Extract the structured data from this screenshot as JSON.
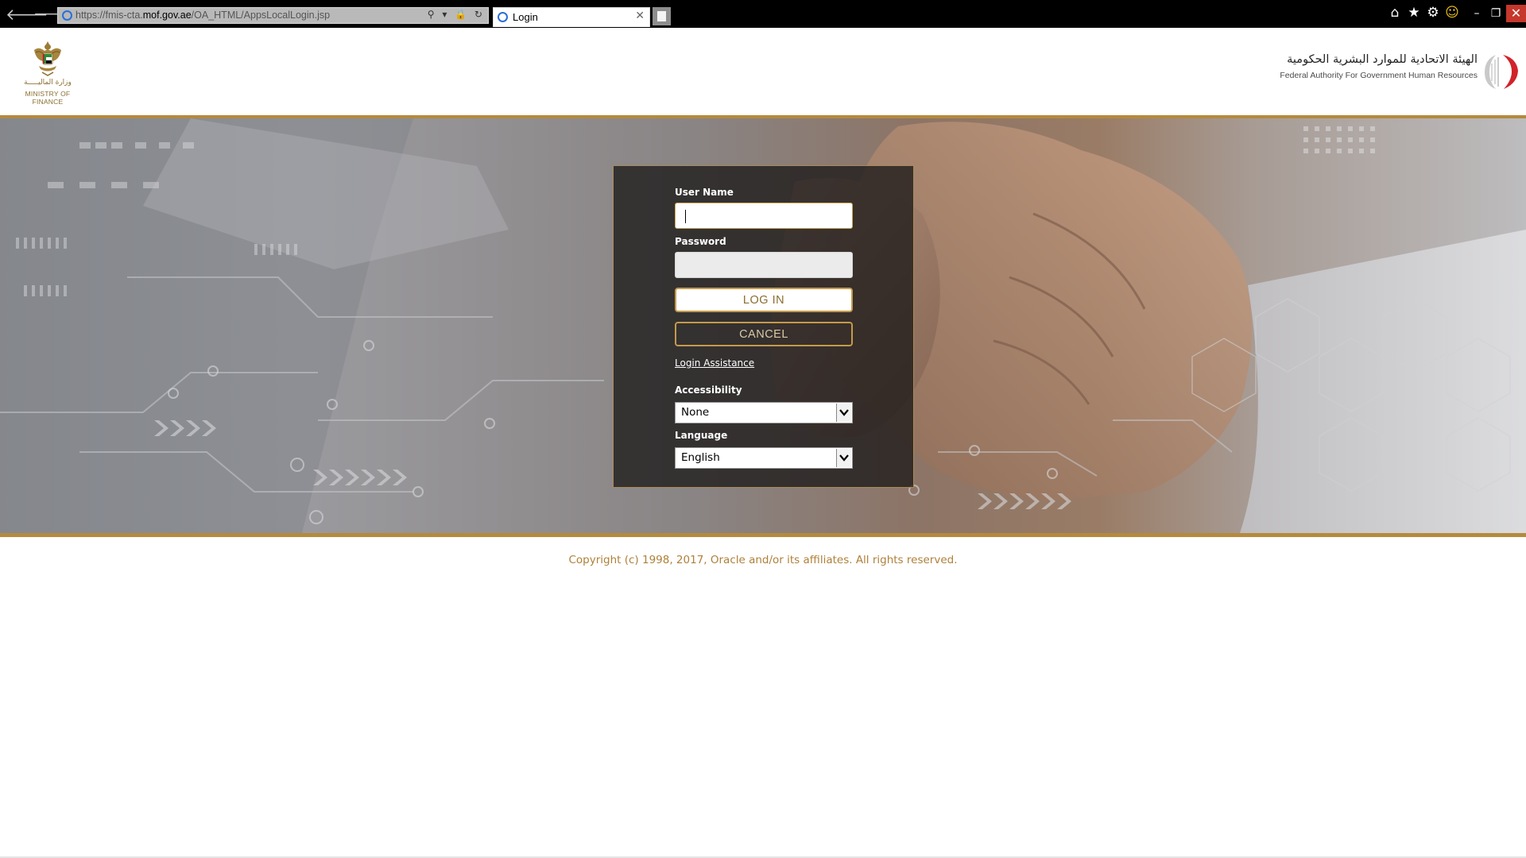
{
  "browser": {
    "url_prefix": "https://fmis-cta.",
    "url_domain": "mof.gov.ae",
    "url_path": "/OA_HTML/AppsLocalLogin.jsp",
    "address_icons": "⚲ ▾ 🔒 ↻",
    "tab_title": "Login",
    "tab_close": "✕",
    "back_icon": "🡐",
    "forward_icon": "🡒",
    "home_icon": "⌂",
    "favorites_icon": "★",
    "settings_icon": "⚙",
    "feedback_icon": "☺",
    "minimize": "–",
    "maximize": "❐",
    "close": "✕"
  },
  "header": {
    "ministry_name_ar": "وزارة الماليـــــة",
    "ministry_name_en": "MINISTRY OF FINANCE",
    "authority_name_ar": "الهيئة الاتحادية للموارد البشرية الحكومية",
    "authority_name_en": "Federal Authority For Government Human Resources"
  },
  "login_form": {
    "username_label": "User Name",
    "username_value": "",
    "password_label": "Password",
    "password_value": "",
    "login_button": "LOG IN",
    "cancel_button": "CANCEL",
    "assistance_link": "Login Assistance",
    "accessibility_label": "Accessibility",
    "accessibility_value": "None",
    "language_label": "Language",
    "language_value": "English"
  },
  "footer": {
    "copyright": "Copyright (c) 1998, 2017, Oracle and/or its affiliates. All rights reserved."
  },
  "colors": {
    "gold_accent": "#b58a3d",
    "panel_background": "#1c1a1a",
    "copyright_text": "#b0803a",
    "close_button": "#c6372c"
  }
}
